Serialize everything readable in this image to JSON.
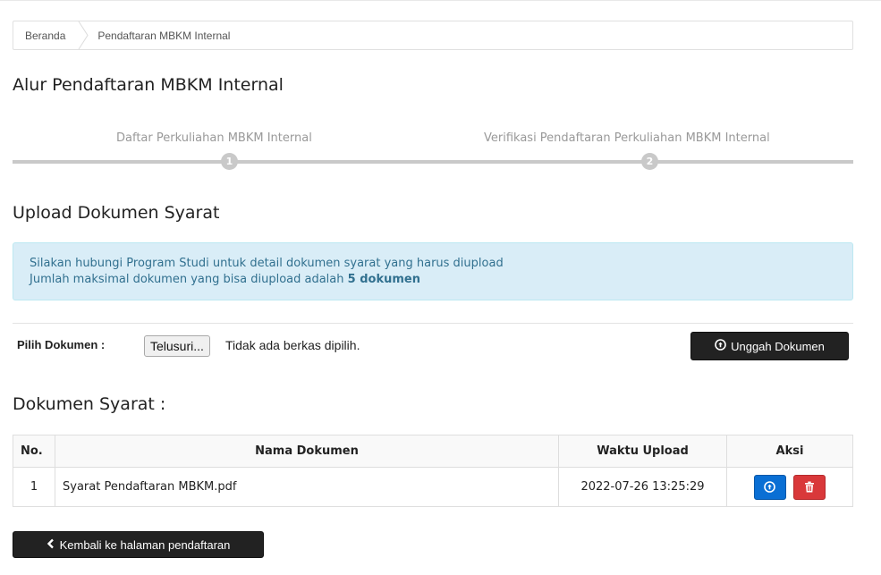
{
  "breadcrumb": {
    "home": "Beranda",
    "current": "Pendaftaran MBKM Internal"
  },
  "wizard": {
    "title": "Alur Pendaftaran MBKM Internal",
    "steps": [
      {
        "label": "Daftar Perkuliahan MBKM Internal",
        "number": "1"
      },
      {
        "label": "Verifikasi Pendaftaran Perkuliahan MBKM Internal",
        "number": "2"
      }
    ]
  },
  "upload": {
    "title": "Upload Dokumen Syarat",
    "info_line1": "Silakan hubungi Program Studi untuk detail dokumen syarat yang harus diupload",
    "info_line2_prefix": "Jumlah maksimal dokumen yang bisa diupload adalah ",
    "info_line2_bold": "5 dokumen",
    "choose_label": "Pilih Dokumen :",
    "browse_button": "Telusuri...",
    "file_status": "Tidak ada berkas dipilih.",
    "upload_button": "Unggah Dokumen"
  },
  "documents": {
    "title": "Dokumen Syarat :",
    "headers": {
      "no": "No.",
      "name": "Nama Dokumen",
      "time": "Waktu Upload",
      "action": "Aksi"
    },
    "rows": [
      {
        "no": "1",
        "name": "Syarat Pendaftaran MBKM.pdf",
        "time": "2022-07-26 13:25:29"
      }
    ]
  },
  "back_button": "Kembali ke halaman pendaftaran",
  "colors": {
    "info_bg": "#d9edf7",
    "info_text": "#31708f",
    "primary": "#0a6fd4",
    "danger": "#d9383a",
    "dark_button": "#222222"
  },
  "icons": {
    "upload": "arrow-circle-up-icon",
    "download": "arrow-circle-down-icon",
    "delete": "trash-icon",
    "back": "chevron-left-icon"
  }
}
